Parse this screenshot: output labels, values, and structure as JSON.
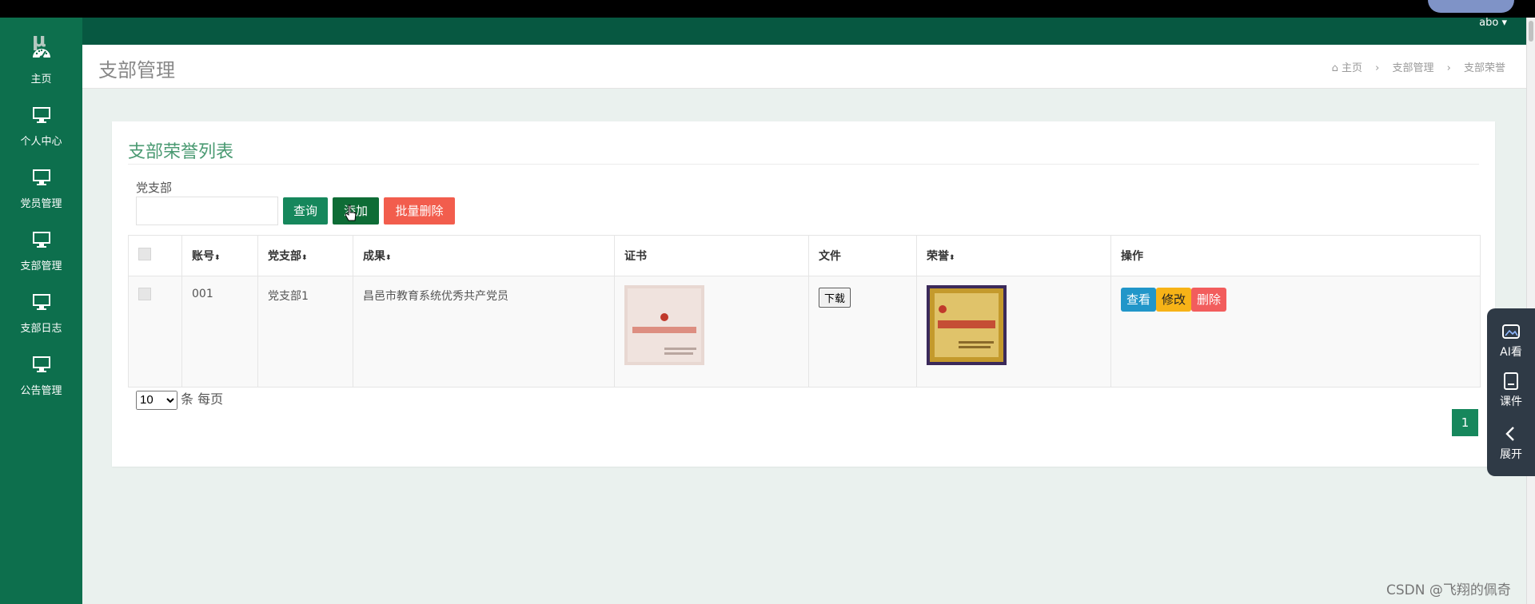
{
  "top": {
    "user_label": "abo ▾"
  },
  "sidebar": {
    "logo": "μ",
    "items": [
      {
        "label": "主页",
        "icon": "dashboard-icon"
      },
      {
        "label": "个人中心",
        "icon": "monitor-icon"
      },
      {
        "label": "党员管理",
        "icon": "monitor-icon"
      },
      {
        "label": "支部管理",
        "icon": "monitor-icon"
      },
      {
        "label": "支部日志",
        "icon": "monitor-icon"
      },
      {
        "label": "公告管理",
        "icon": "monitor-icon"
      }
    ]
  },
  "page": {
    "title": "支部管理",
    "breadcrumb": [
      "主页",
      "支部管理",
      "支部荣誉"
    ]
  },
  "card": {
    "title": "支部荣誉列表",
    "filter_label": "党支部",
    "filter_value": "",
    "buttons": {
      "query": "查询",
      "add": "添加",
      "batch_delete": "批量删除"
    }
  },
  "table": {
    "headers": [
      "账号",
      "党支部",
      "成果",
      "证书",
      "文件",
      "荣誉",
      "操作"
    ],
    "rows": [
      {
        "account": "001",
        "branch": "党支部1",
        "achievement": "昌邑市教育系统优秀共产党员",
        "file_button": "下载",
        "actions": {
          "view": "查看",
          "edit": "修改",
          "delete": "删除"
        }
      }
    ]
  },
  "pagination": {
    "page_size": "10",
    "per_page_suffix": "条 每页",
    "current_page": "1"
  },
  "float_tools": [
    {
      "label": "AI看",
      "icon": "ai-image-icon"
    },
    {
      "label": "课件",
      "icon": "courseware-icon"
    },
    {
      "label": "展开",
      "icon": "chevron-left-icon"
    }
  ],
  "watermark": "CSDN @飞翔的佩奇",
  "colors": {
    "sidebar": "#0d6f4d",
    "header": "#075841",
    "accent": "#16875c",
    "danger": "#f25d4d",
    "warning": "#f7b317",
    "info": "#2196c9"
  }
}
